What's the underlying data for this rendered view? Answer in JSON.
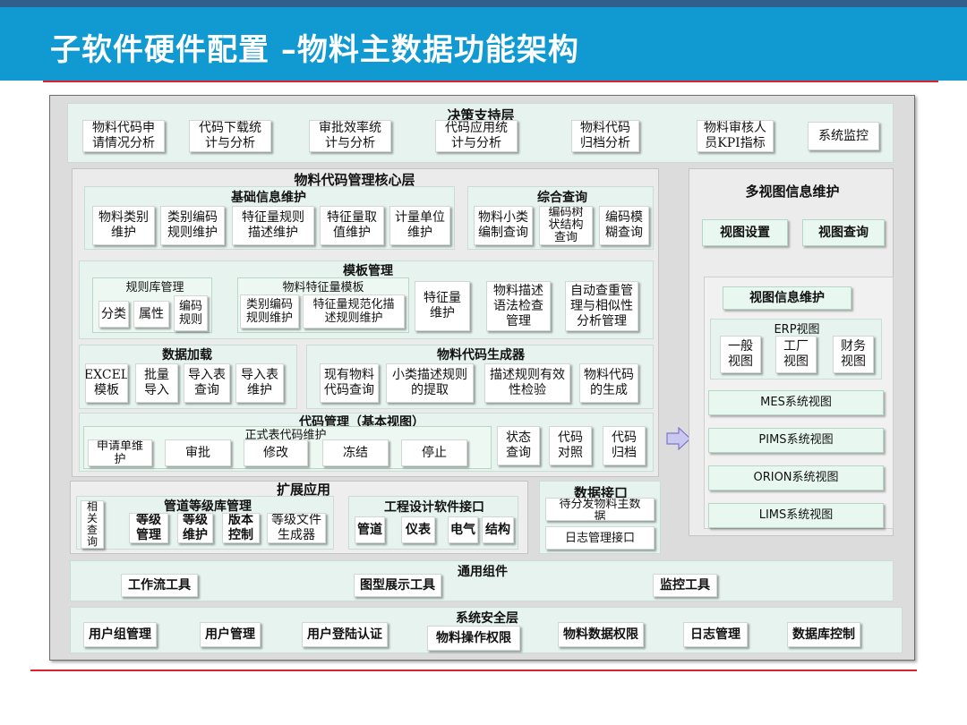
{
  "header": {
    "title": "子软件硬件配置 –物料主数据功能架构"
  },
  "decision": {
    "title": "决策支持层",
    "items": [
      "物料代码申\n请情况分析",
      "代码下载统\n计与分析",
      "审批效率统\n计与分析",
      "代码应用统\n计与分析",
      "物料代码\n归档分析",
      "物料审核人\n员KPI指标",
      "系统监控"
    ]
  },
  "core": {
    "title": "物料代码管理核心层",
    "basic": {
      "title": "基础信息维护",
      "items": [
        "物料类别\n维护",
        "类别编码\n规则维护",
        "特征量规则\n描述维护",
        "特征量取\n值维护",
        "计量单位\n维护"
      ]
    },
    "query": {
      "title": "综合查询",
      "items": [
        "物料小类\n编制查询",
        "编码树\n状结构\n查询",
        "编码模\n糊查询"
      ]
    },
    "template": {
      "title": "模板管理",
      "rule_lib": {
        "title": "规则库管理",
        "items": [
          "分类",
          "属性",
          "编码\n规则"
        ]
      },
      "feature_tpl": {
        "title": "物料特征量模板",
        "items": [
          "类别编码\n规则维护",
          "特征量规范化描\n述规则维护"
        ]
      },
      "items": [
        "特征量\n维护",
        "物料描述\n语法检查\n管理",
        "自动查重管\n理与相似性\n分析管理"
      ]
    },
    "loading": {
      "title": "数据加载",
      "items": [
        "EXCEL\n模板",
        "批量\n导入",
        "导入表\n查询",
        "导入表\n维护"
      ]
    },
    "generator": {
      "title": "物料代码生成器",
      "items": [
        "现有物料\n代码查询",
        "小类描述规则\n的提取",
        "描述规则有效\n性检验",
        "物料代码\n的生成"
      ]
    },
    "code_mgmt": {
      "title": "代码管理（基本视图）",
      "formal_title": "正式表代码维护",
      "items": [
        "申请单维\n护",
        "审批",
        "修改",
        "冻结",
        "停止"
      ],
      "right_items": [
        "状态\n查询",
        "代码\n对照",
        "代码\n归档"
      ]
    }
  },
  "multiview": {
    "title": "多视图信息维护",
    "buttons": [
      "视图设置",
      "视图查询"
    ],
    "info": {
      "title": "视图信息维护",
      "erp": {
        "title": "ERP视图",
        "items": [
          "一般\n视图",
          "工厂\n视图",
          "财务\n视图"
        ]
      },
      "systems": [
        "MES系统视图",
        "PIMS系统视图",
        "ORION系统视图",
        "LIMS系统视图"
      ]
    }
  },
  "extension": {
    "title": "扩展应用",
    "pipe": {
      "title": "管道等级库管理",
      "items": [
        "相\n关\n查\n询",
        "等级\n管理",
        "等级\n维护",
        "版本\n控制",
        "等级文件\n生成器"
      ]
    },
    "eng": {
      "title": "工程设计软件接口",
      "items": [
        "管道",
        "仪表",
        "电气",
        "结构"
      ]
    }
  },
  "interface": {
    "title": "数据接口",
    "items": [
      "待分发物料主数\n据",
      "日志管理接口"
    ]
  },
  "common": {
    "title": "通用组件",
    "items": [
      "工作流工具",
      "图型展示工具",
      "监控工具"
    ]
  },
  "security": {
    "title": "系统安全层",
    "items": [
      "用户组管理",
      "用户管理",
      "用户登陆认证",
      "物料操作权限",
      "物料数据权限",
      "日志管理",
      "数据库控制"
    ]
  },
  "colors": {
    "header_bg": "#119ad2",
    "top_bar": "#2f5f8a",
    "accent_line": "#e0202a",
    "panel": "#e6f3ee",
    "arrow": "#c9c8f0"
  }
}
